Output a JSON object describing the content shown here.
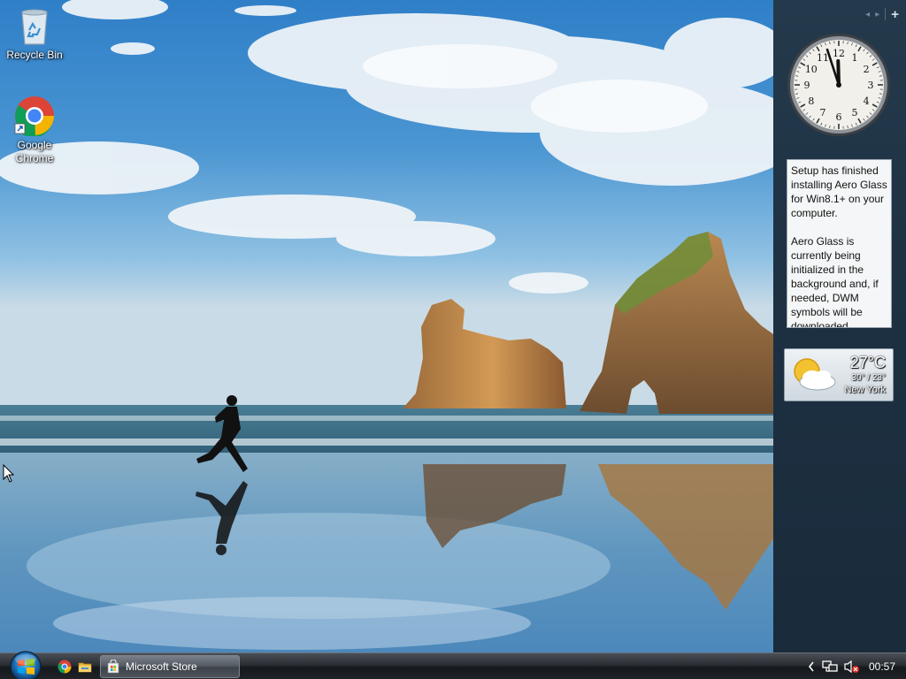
{
  "desktop": {
    "icons": [
      {
        "label": "Recycle Bin",
        "icon": "recycle-bin-icon"
      },
      {
        "label": "Google Chrome",
        "icon": "chrome-icon"
      }
    ]
  },
  "sidebar": {
    "nav": {
      "prev": "◂",
      "next": "▸",
      "add": "+"
    },
    "clock": {
      "hour": 11,
      "minute": 57,
      "numerals": [
        "12",
        "1",
        "2",
        "3",
        "4",
        "5",
        "6",
        "7",
        "8",
        "9",
        "10",
        "11"
      ]
    },
    "notification": {
      "paragraph1": "Setup has finished installing Aero Glass for Win8.1+ on your computer.",
      "paragraph2": "Aero Glass is currently being initialized in the background and, if needed, DWM symbols will be downloaded."
    },
    "weather": {
      "temperature": "27°C",
      "range": "30° / 23°",
      "city": "New York",
      "icon": "partly-cloudy-icon"
    }
  },
  "taskbar": {
    "start_icon": "windows-start-orb",
    "quick_launch": [
      "chrome-icon",
      "file-explorer-icon"
    ],
    "tasks": [
      {
        "label": "Microsoft Store",
        "icon": "store-bag-icon"
      }
    ],
    "tray": {
      "chevron": "show-hidden-icons",
      "network": "network-icon",
      "volume": "volume-muted-icon",
      "time": "00:57"
    }
  },
  "colors": {
    "sidebar_bg": "#1d3142",
    "taskbar_bg": "#1f2328",
    "notification_bg": "#f5f6f7",
    "sky": "#3a86c6"
  }
}
